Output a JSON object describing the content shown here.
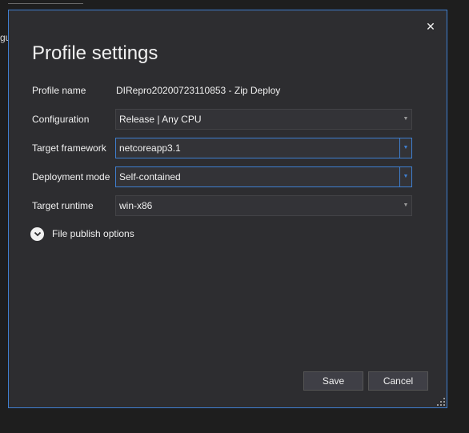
{
  "background": {
    "fragment_text": "gu"
  },
  "dialog": {
    "title": "Profile settings",
    "close_glyph": "✕",
    "profile_name": {
      "label": "Profile name",
      "value": "DIRepro20200723110853 - Zip Deploy"
    },
    "configuration": {
      "label": "Configuration",
      "value": "Release | Any CPU"
    },
    "target_framework": {
      "label": "Target framework",
      "value": "netcoreapp3.1"
    },
    "deployment_mode": {
      "label": "Deployment mode",
      "value": "Self-contained"
    },
    "target_runtime": {
      "label": "Target runtime",
      "value": "win-x86"
    },
    "file_publish_options": {
      "label": "File publish options",
      "icon": "chevron-down-circle-icon"
    },
    "save_label": "Save",
    "cancel_label": "Cancel"
  },
  "colors": {
    "dialog_bg": "#2d2d30",
    "accent": "#3f7fd0",
    "text": "#f1f1f1",
    "input_bg": "#333337"
  }
}
